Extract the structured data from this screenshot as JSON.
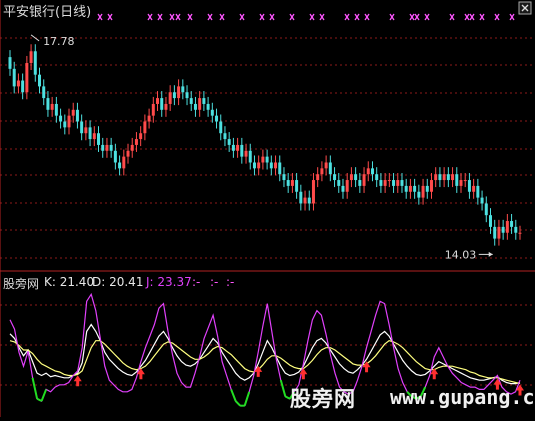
{
  "header": {
    "title": "平安银行(日线)"
  },
  "price_panel": {
    "high_label": "17.78",
    "low_label": "14.03"
  },
  "indicator_panel": {
    "name": "股旁网",
    "k_text": "K: 21.40",
    "d_text": "D: 20.41",
    "j_text": "J: 23.37",
    "extra": [
      ":-",
      ":-",
      ":-"
    ]
  },
  "watermark": {
    "text": "股旁网",
    "url": "www.gupang.com"
  },
  "colors": {
    "background": "#000000",
    "up": "#ff4b4b",
    "down": "#4de0e0",
    "grid": "#8b1a1a",
    "k_line": "#ffffff",
    "d_line": "#ffff80",
    "j_line": "#e040fb",
    "low_zone": "#22dd22",
    "signal_arrow": "#ff3030",
    "marker": "#ff55ff"
  },
  "icons": [
    "close-icon",
    "buy-arrow-icon",
    "marker-x-icon"
  ],
  "chart_data": [
    {
      "type": "candlestick",
      "title": "平安银行(日线)",
      "annotations": [
        {
          "label": "17.78",
          "value": 17.78
        },
        {
          "label": "14.03",
          "value": 14.03
        }
      ],
      "series": [
        {
          "close": [
            17.2,
            16.9,
            17.0,
            16.8,
            17.3,
            17.5,
            17.1,
            16.9,
            16.7,
            16.5,
            16.6,
            16.4,
            16.3,
            16.2,
            16.4,
            16.5,
            16.3,
            16.1,
            16.2,
            16.0,
            16.1,
            15.9,
            15.8,
            15.9,
            15.8,
            15.6,
            15.5,
            15.7,
            15.8,
            15.9,
            16.0,
            16.1,
            16.3,
            16.4,
            16.6,
            16.7,
            16.5,
            16.6,
            16.8,
            16.7,
            16.9,
            16.8,
            16.7,
            16.6,
            16.5,
            16.7,
            16.6,
            16.5,
            16.4,
            16.3,
            16.1,
            16.0,
            15.9,
            15.8,
            15.9,
            15.7,
            15.8,
            15.6,
            15.5,
            15.6,
            15.7,
            15.6,
            15.5,
            15.6,
            15.4,
            15.3,
            15.2,
            15.3,
            15.1,
            14.9,
            15.0,
            14.9,
            15.3,
            15.4,
            15.5,
            15.6,
            15.4,
            15.3,
            15.2,
            15.1,
            15.3,
            15.4,
            15.3,
            15.2,
            15.4,
            15.5,
            15.4,
            15.3,
            15.2,
            15.3,
            15.3,
            15.2,
            15.3,
            15.2,
            15.1,
            15.2,
            15.1,
            15.0,
            15.2,
            15.1,
            15.3,
            15.4,
            15.3,
            15.4,
            15.3,
            15.4,
            15.2,
            15.3,
            15.3,
            15.1,
            15.2,
            15.0,
            14.9,
            14.7,
            14.5,
            14.3,
            14.5,
            14.4,
            14.6,
            14.5,
            14.4,
            14.4
          ]
        }
      ]
    },
    {
      "type": "line",
      "series": [
        {
          "name": "K",
          "values": [
            64,
            60,
            52,
            45,
            50,
            40,
            30,
            28,
            30,
            27,
            28,
            27,
            26,
            26,
            28,
            30,
            39,
            66,
            72,
            66,
            58,
            48,
            42,
            38,
            34,
            31,
            29,
            28,
            31,
            36,
            41,
            48,
            55,
            62,
            66,
            60,
            52,
            45,
            40,
            37,
            36,
            38,
            42,
            48,
            54,
            60,
            56,
            48,
            42,
            36,
            30,
            26,
            24,
            26,
            30,
            38,
            48,
            58,
            52,
            44,
            36,
            30,
            28,
            29,
            31,
            36,
            44,
            52,
            58,
            60,
            56,
            50,
            44,
            38,
            34,
            31,
            30,
            33,
            37,
            42,
            49,
            56,
            63,
            66,
            62,
            55,
            48,
            41,
            36,
            32,
            29,
            28,
            29,
            32,
            36,
            40,
            38,
            36,
            34,
            32,
            30,
            28,
            26,
            25,
            24,
            24,
            25,
            26,
            27,
            24,
            22,
            21,
            21,
            22
          ]
        },
        {
          "name": "D",
          "values": [
            58,
            57,
            54,
            50,
            50,
            47,
            42,
            38,
            36,
            34,
            32,
            31,
            29,
            28,
            28,
            29,
            32,
            42,
            52,
            58,
            58,
            55,
            51,
            47,
            43,
            39,
            36,
            34,
            33,
            34,
            36,
            40,
            45,
            50,
            55,
            57,
            56,
            53,
            50,
            47,
            44,
            42,
            42,
            44,
            47,
            51,
            53,
            52,
            49,
            46,
            42,
            38,
            34,
            32,
            31,
            33,
            37,
            42,
            45,
            45,
            43,
            40,
            37,
            35,
            34,
            34,
            37,
            41,
            46,
            50,
            52,
            52,
            50,
            47,
            44,
            41,
            38,
            37,
            37,
            38,
            41,
            45,
            50,
            55,
            58,
            57,
            55,
            52,
            48,
            44,
            40,
            37,
            34,
            33,
            33,
            35,
            36,
            36,
            36,
            35,
            34,
            33,
            31,
            30,
            28,
            27,
            26,
            26,
            26,
            25,
            24,
            23,
            22,
            21
          ]
        },
        {
          "name": "J",
          "values": [
            76,
            68,
            48,
            36,
            49,
            26,
            8,
            6,
            16,
            14,
            18,
            20,
            20,
            22,
            28,
            32,
            52,
            92,
            98,
            84,
            60,
            36,
            24,
            20,
            16,
            14,
            14,
            16,
            26,
            40,
            52,
            62,
            72,
            86,
            90,
            66,
            46,
            30,
            22,
            18,
            18,
            30,
            44,
            60,
            70,
            80,
            62,
            40,
            28,
            16,
            6,
            2,
            2,
            14,
            28,
            48,
            70,
            90,
            66,
            42,
            24,
            10,
            8,
            14,
            20,
            38,
            58,
            76,
            84,
            80,
            64,
            46,
            30,
            18,
            14,
            12,
            14,
            24,
            36,
            52,
            66,
            80,
            92,
            90,
            72,
            52,
            34,
            22,
            14,
            10,
            8,
            10,
            18,
            28,
            44,
            52,
            44,
            36,
            30,
            26,
            22,
            20,
            18,
            18,
            16,
            16,
            20,
            24,
            28,
            18,
            14,
            12,
            14,
            24
          ]
        }
      ]
    }
  ]
}
